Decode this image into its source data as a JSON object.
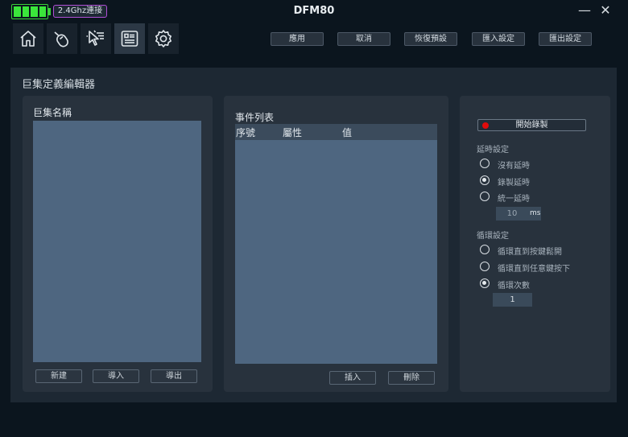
{
  "app": {
    "title": "DFM80",
    "connection": "2.4Ghz連接",
    "battery_level": 1.0
  },
  "window_controls": {
    "minimize": "—",
    "close": "✕"
  },
  "nav": [
    {
      "icon": "home-icon"
    },
    {
      "icon": "mouse-icon"
    },
    {
      "icon": "pointer-list-icon"
    },
    {
      "icon": "macro-editor-icon",
      "active": true
    },
    {
      "icon": "gear-icon"
    }
  ],
  "toolbar": {
    "apply": "應用",
    "cancel": "取消",
    "restore_default": "恢復預設",
    "import_settings": "匯入設定",
    "export_settings": "匯出設定"
  },
  "editor": {
    "title": "巨集定義編輯器",
    "macro_list": {
      "label": "巨集名稱",
      "new": "新建",
      "import": "導入",
      "export": "導出"
    },
    "event_list": {
      "label": "事件列表",
      "columns": [
        "序號",
        "屬性",
        "值"
      ],
      "insert": "插入",
      "delete": "刪除"
    },
    "record": {
      "start_label": "開始錄製"
    },
    "delay": {
      "label": "延時設定",
      "options": [
        "沒有延時",
        "錄製延時",
        "統一延時"
      ],
      "selected": 1,
      "value": "10",
      "unit": "ms"
    },
    "loop": {
      "label": "循環設定",
      "options": [
        "循環直到按鍵鬆開",
        "循環直到任意鍵按下",
        "循環次數"
      ],
      "selected": 2,
      "count": "1"
    }
  },
  "colors": {
    "background": "#0b151e",
    "panel": "#1d2833",
    "card": "#28323d",
    "list_area": "#4e6680",
    "battery": "#3be63b",
    "connection_border": "#b04fd6",
    "record": "#e10b0b"
  }
}
